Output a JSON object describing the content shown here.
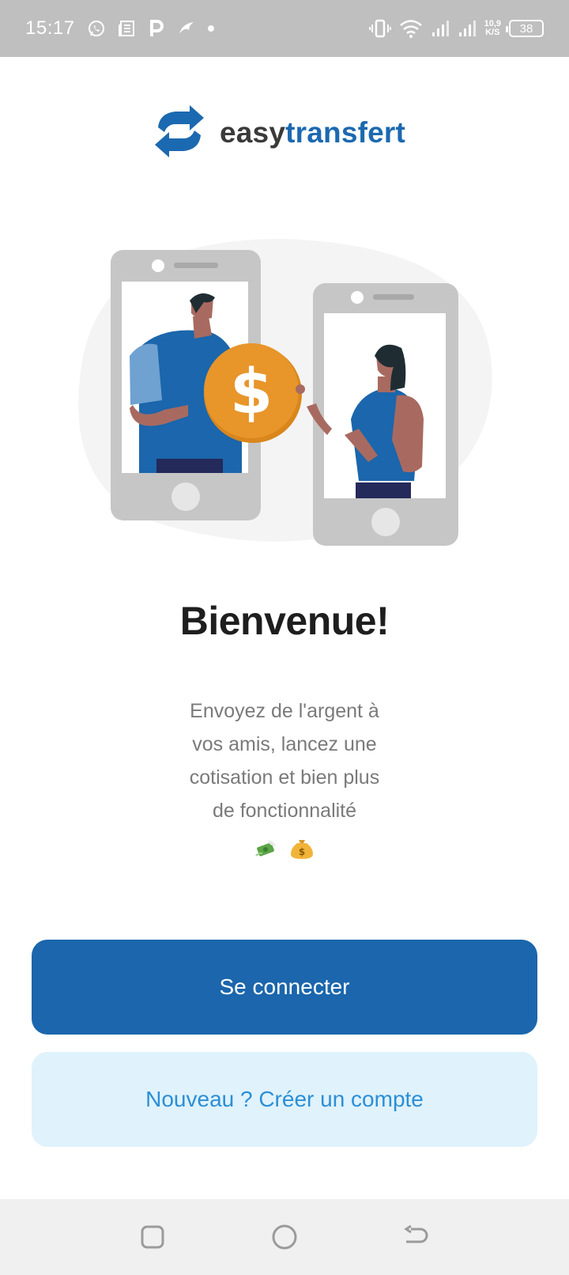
{
  "status_bar": {
    "time": "15:17",
    "net_speed_value": "10,9",
    "net_speed_unit": "K/S",
    "battery": "38",
    "left_icons": [
      "whatsapp-icon",
      "news-icon",
      "p-app-icon",
      "bird-app-icon"
    ],
    "right_icons": [
      "vibrate-icon",
      "wifi-icon",
      "signal-icon",
      "signal-icon"
    ]
  },
  "logo": {
    "part1": "easy",
    "part2": "transfert",
    "colors": {
      "dark": "#3a3a3a",
      "brand_blue": "#1b69b0"
    }
  },
  "welcome": {
    "title": "Bienvenue!",
    "line1": "Envoyez de l'argent à",
    "line2": "vos amis, lancez une",
    "line3": "cotisation et bien plus",
    "line4": "de fonctionnalité",
    "emojis": [
      "money-with-wings-emoji",
      "money-bag-emoji"
    ]
  },
  "buttons": {
    "login_label": "Se connecter",
    "signup_label": "Nouveau ? Créer un compte",
    "colors": {
      "primary": "#1b66ac",
      "secondary_bg": "#e0f2fb",
      "secondary_text": "#2b8fd6"
    }
  },
  "nav_bar": {
    "items": [
      "recent-apps-icon",
      "home-icon",
      "back-icon"
    ]
  }
}
